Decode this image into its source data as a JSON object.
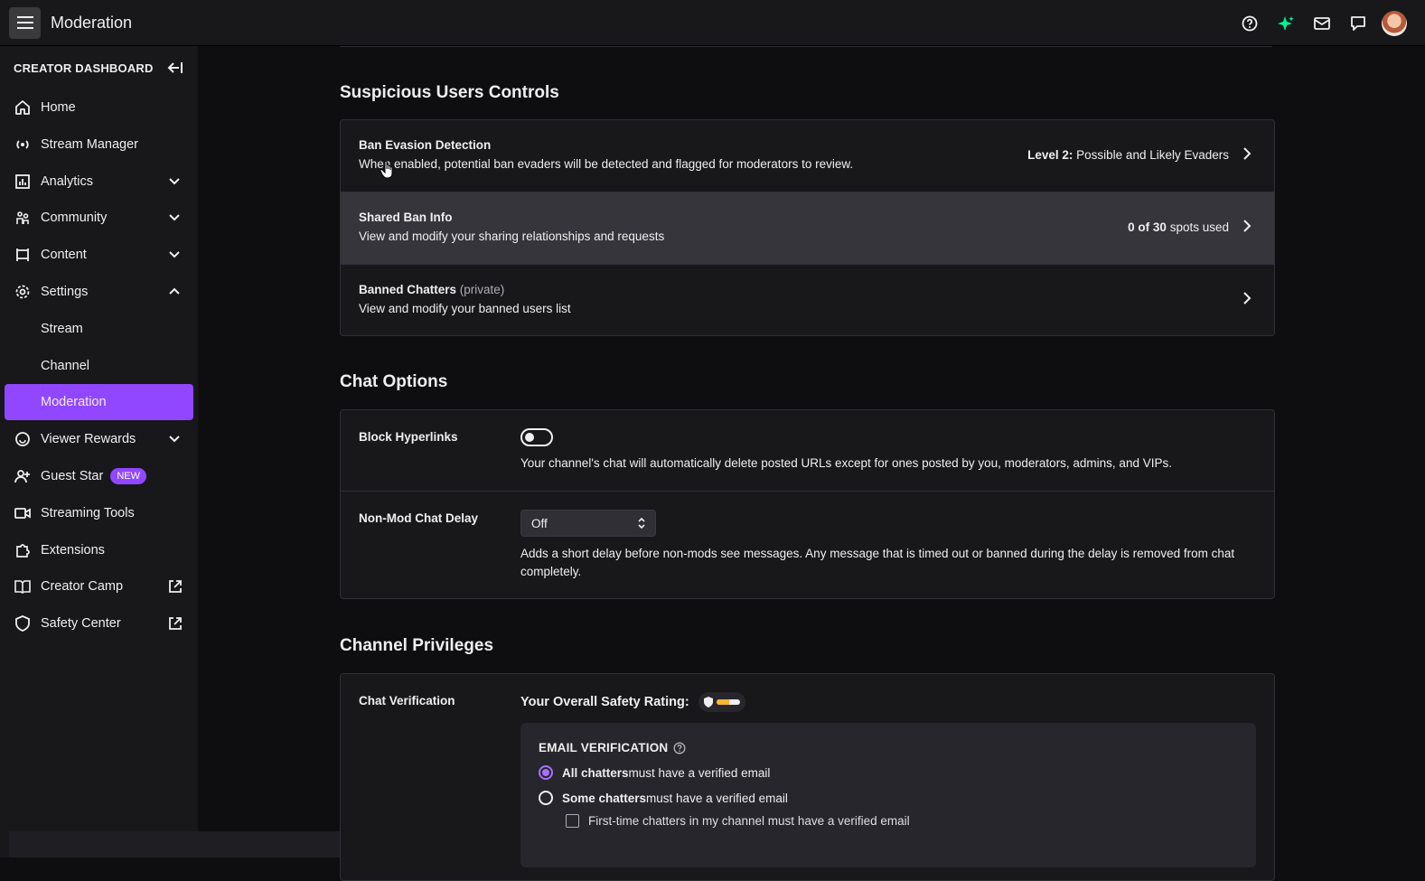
{
  "header": {
    "title": "Moderation"
  },
  "sidebar": {
    "title": "CREATOR DASHBOARD",
    "items": [
      {
        "label": "Home",
        "icon": "home-icon"
      },
      {
        "label": "Stream Manager",
        "icon": "broadcast-icon"
      },
      {
        "label": "Analytics",
        "icon": "analytics-icon"
      },
      {
        "label": "Community",
        "icon": "community-icon"
      },
      {
        "label": "Content",
        "icon": "content-icon"
      },
      {
        "label": "Settings",
        "icon": "gear-icon"
      },
      {
        "label": "Stream"
      },
      {
        "label": "Channel"
      },
      {
        "label": "Moderation"
      },
      {
        "label": "Viewer Rewards",
        "icon": "rewards-icon"
      },
      {
        "label": "Guest Star",
        "icon": "guest-star-icon",
        "badge": "NEW"
      },
      {
        "label": "Streaming Tools",
        "icon": "camera-icon"
      },
      {
        "label": "Extensions",
        "icon": "puzzle-icon"
      },
      {
        "label": "Creator Camp",
        "icon": "book-icon"
      },
      {
        "label": "Safety Center",
        "icon": "shield-icon"
      }
    ]
  },
  "suspicious": {
    "title": "Suspicious Users Controls",
    "rows": [
      {
        "title": "Ban Evasion Detection",
        "desc": "When enabled, potential ban evaders will be detected and flagged for moderators to review.",
        "value_bold": "Level 2:",
        "value_rest": " Possible and Likely Evaders"
      },
      {
        "title": "Shared Ban Info",
        "desc": "View and modify your sharing relationships and requests",
        "value_bold": "0 of 30",
        "value_rest": " spots used"
      },
      {
        "title": "Banned Chatters",
        "title_note": "(private)",
        "desc": "View and modify your banned users list"
      }
    ]
  },
  "chat_options": {
    "title": "Chat Options",
    "block_hyperlinks": {
      "label": "Block Hyperlinks",
      "desc": "Your channel's chat will automatically delete posted URLs except for ones posted by you, moderators, admins, and VIPs."
    },
    "chat_delay": {
      "label": "Non-Mod Chat Delay",
      "value": "Off",
      "desc": "Adds a short delay before non-mods see messages. Any message that is timed out or banned during the delay is removed from chat completely."
    }
  },
  "privileges": {
    "title": "Channel Privileges",
    "chat_verification": {
      "label": "Chat Verification",
      "safety_label": "Your Overall Safety Rating:",
      "safety_level": 0.55,
      "email_head": "EMAIL VERIFICATION",
      "option_all_bold": "All chatters",
      "option_all_rest": " must have a verified email",
      "option_some_bold": "Some chatters",
      "option_some_rest": " must have a verified email",
      "check_first_time": "First-time chatters in my channel must have a verified email"
    }
  },
  "colors": {
    "accent": "#9147ff",
    "background": "#0e0e10",
    "panel": "#18181b",
    "safety": "#f5b82e"
  }
}
